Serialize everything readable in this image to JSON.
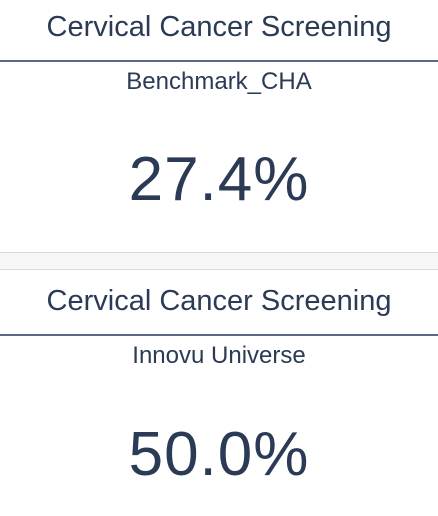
{
  "tiles": [
    {
      "title": "Cervical Cancer Screening",
      "subtitle": "Benchmark_CHA",
      "value": "27.4%"
    },
    {
      "title": "Cervical Cancer Screening",
      "subtitle": "Innovu Universe",
      "value": "50.0%"
    }
  ],
  "colors": {
    "text": "#2b3a55",
    "rule": "#5a6a86",
    "background": "#ffffff",
    "divider": "#d9d9d9"
  }
}
